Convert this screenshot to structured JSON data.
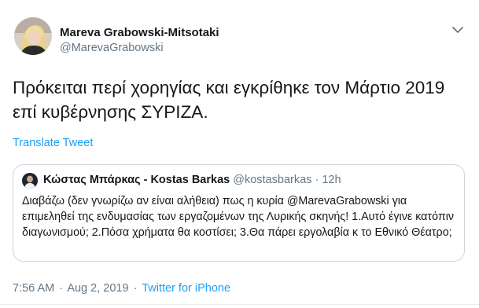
{
  "tweet": {
    "author_name": "Mareva Grabowski-Mitsotaki",
    "author_handle": "@MarevaGrabowski",
    "text": "Πρόκειται περί χορηγίας  και εγκρίθηκε τον Μάρτιο 2019 επί κυβέρνησης ΣΥΡΙΖΑ.",
    "translate_label": "Translate Tweet",
    "menu_icon": "chevron-down-icon"
  },
  "quoted": {
    "author_name": "Κώστας Μπάρκας - Kostas Barkas",
    "author_handle": "@kostasbarkas",
    "separator": "·",
    "time": "12h",
    "text": "Διαβάζω (δεν γνωρίζω αν είναι αλήθεια) πως η κυρία @MarevaGrabowski για επιμεληθεί της ενδυμασίας των εργαζομένων της Λυρικής σκηνής! 1.Αυτό έγινε κατόπιν διαγωνισμού; 2.Πόσα χρήματα θα κοστίσει; 3.Θα πάρει εργολαβία κ το Εθνικό Θέατρο;"
  },
  "footer": {
    "time": "7:56 AM",
    "separator": "·",
    "date": "Aug 2, 2019",
    "source": "Twitter for iPhone"
  },
  "colors": {
    "link": "#1da1f2",
    "secondary_text": "#657786",
    "border": "#ccd6dd"
  }
}
